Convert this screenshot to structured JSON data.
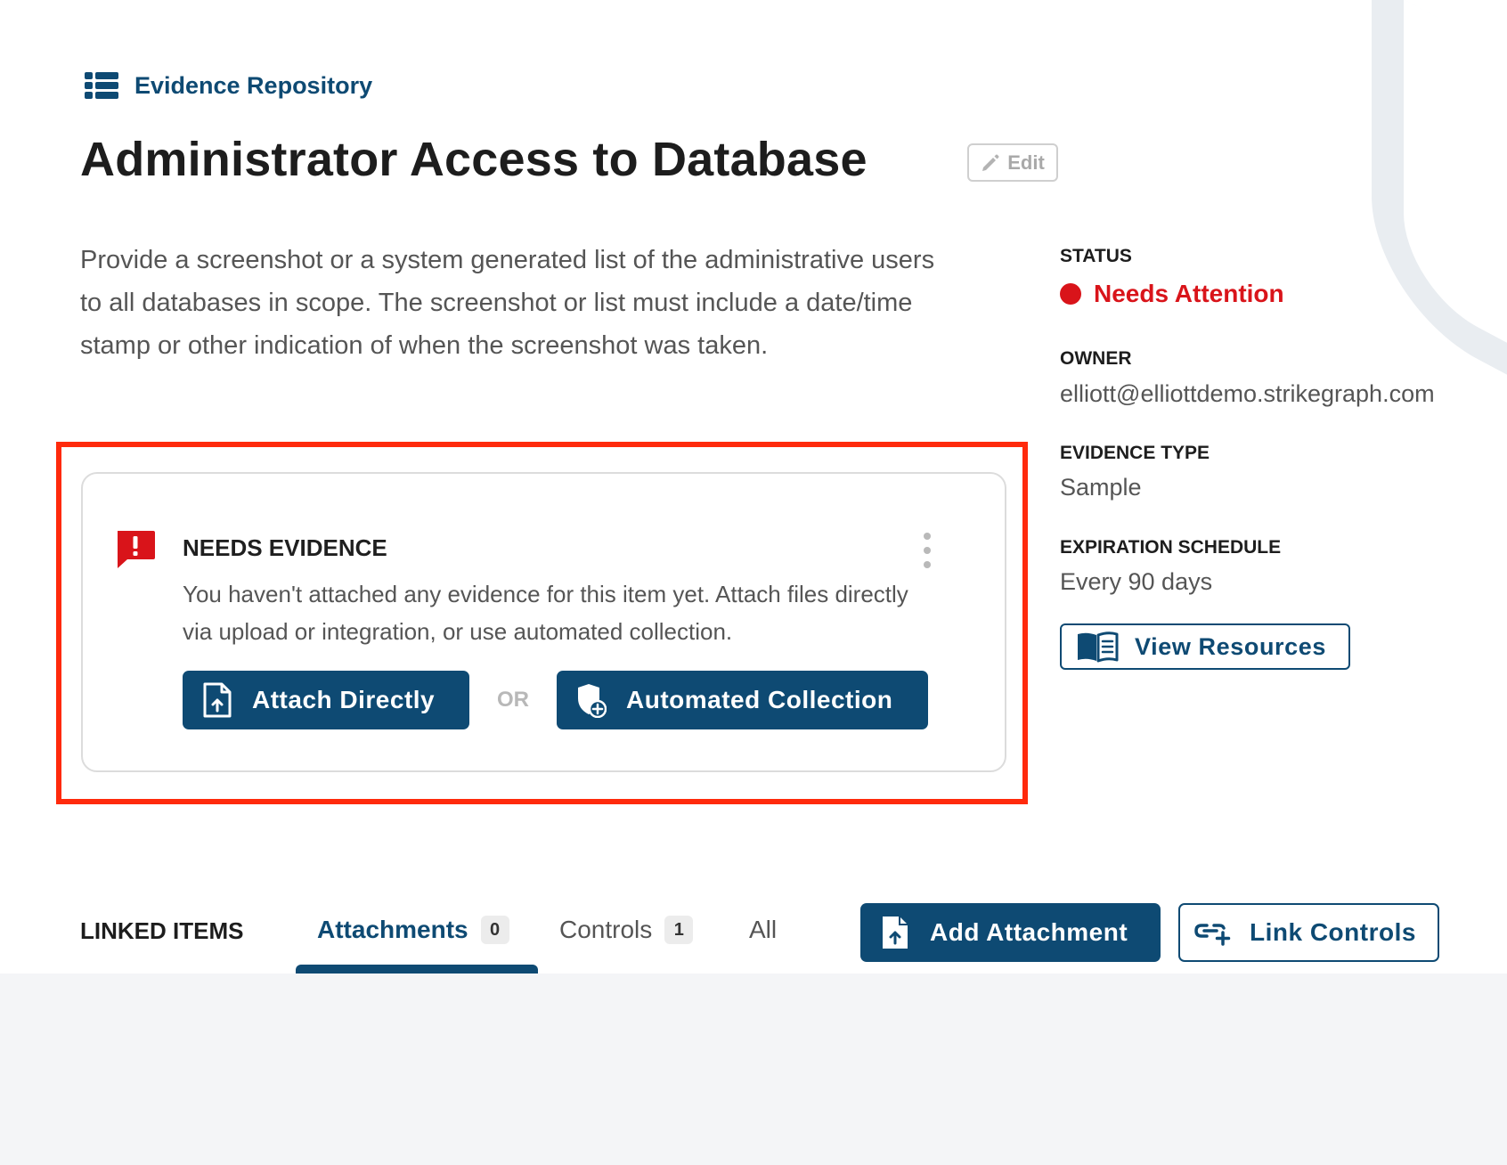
{
  "breadcrumb": {
    "label": "Evidence Repository",
    "icon": "list-icon"
  },
  "page": {
    "title": "Administrator Access to Database",
    "edit_label": "Edit",
    "description": "Provide a screenshot or a system generated list of the administrative users to all databases in scope. The screenshot or list must include a date/time stamp or other indication of when the screenshot was taken."
  },
  "evidence_card": {
    "title": "NEEDS EVIDENCE",
    "message": "You haven't attached any evidence for this item yet. Attach files directly via upload or integration, or use automated collection.",
    "attach_label": "Attach Directly",
    "or_label": "OR",
    "automated_label": "Automated Collection",
    "alert_color": "#d9141a"
  },
  "details": {
    "status_label": "STATUS",
    "status_value": "Needs Attention",
    "owner_label": "OWNER",
    "owner_value": "elliott@elliottdemo.strikegraph.com",
    "evidence_type_label": "EVIDENCE TYPE",
    "evidence_type_value": "Sample",
    "expiration_label": "EXPIRATION SCHEDULE",
    "expiration_value": "Every 90 days",
    "resources_label": "View Resources"
  },
  "linked_items": {
    "label": "LINKED ITEMS",
    "tabs": [
      {
        "label": "Attachments",
        "count": "0",
        "active": true
      },
      {
        "label": "Controls",
        "count": "1",
        "active": false
      },
      {
        "label": "All",
        "count": "",
        "active": false
      }
    ],
    "add_attachment_label": "Add Attachment",
    "link_controls_label": "Link Controls"
  },
  "colors": {
    "brand": "#0e4a73",
    "danger": "#d9141a",
    "highlight": "#ff2a0c"
  }
}
